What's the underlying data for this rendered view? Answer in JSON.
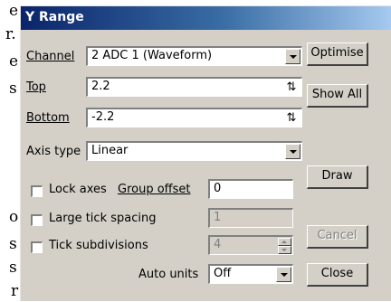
{
  "background_text": [
    "e",
    "r.",
    "e",
    "s",
    "o",
    "s",
    "s",
    "r"
  ],
  "dialog": {
    "title": "Y Range",
    "channel": {
      "label": "Channel",
      "value": "2 ADC 1 (Waveform)"
    },
    "top": {
      "label": "Top",
      "value": "2.2"
    },
    "bottom": {
      "label": "Bottom",
      "value": "-2.2"
    },
    "axis_type": {
      "label": "Axis type",
      "value": "Linear"
    },
    "lock_axes": {
      "label": "Lock axes",
      "checked": false
    },
    "group_offset": {
      "label": "Group offset",
      "value": "0"
    },
    "large_tick_spacing": {
      "label": "Large tick spacing",
      "checked": false,
      "value": "1"
    },
    "tick_subdivisions": {
      "label": "Tick subdivisions",
      "checked": false,
      "value": "4"
    },
    "auto_units": {
      "label": "Auto units",
      "value": "Off"
    },
    "buttons": {
      "optimise": "Optimise",
      "show_all": "Show All",
      "draw": "Draw",
      "cancel": "Cancel",
      "close": "Close"
    },
    "colors": {
      "title_bar_start": "#0a246a",
      "title_bar_end": "#a6caf0",
      "face": "#d4d0c8",
      "disabled_text": "#808080"
    }
  }
}
